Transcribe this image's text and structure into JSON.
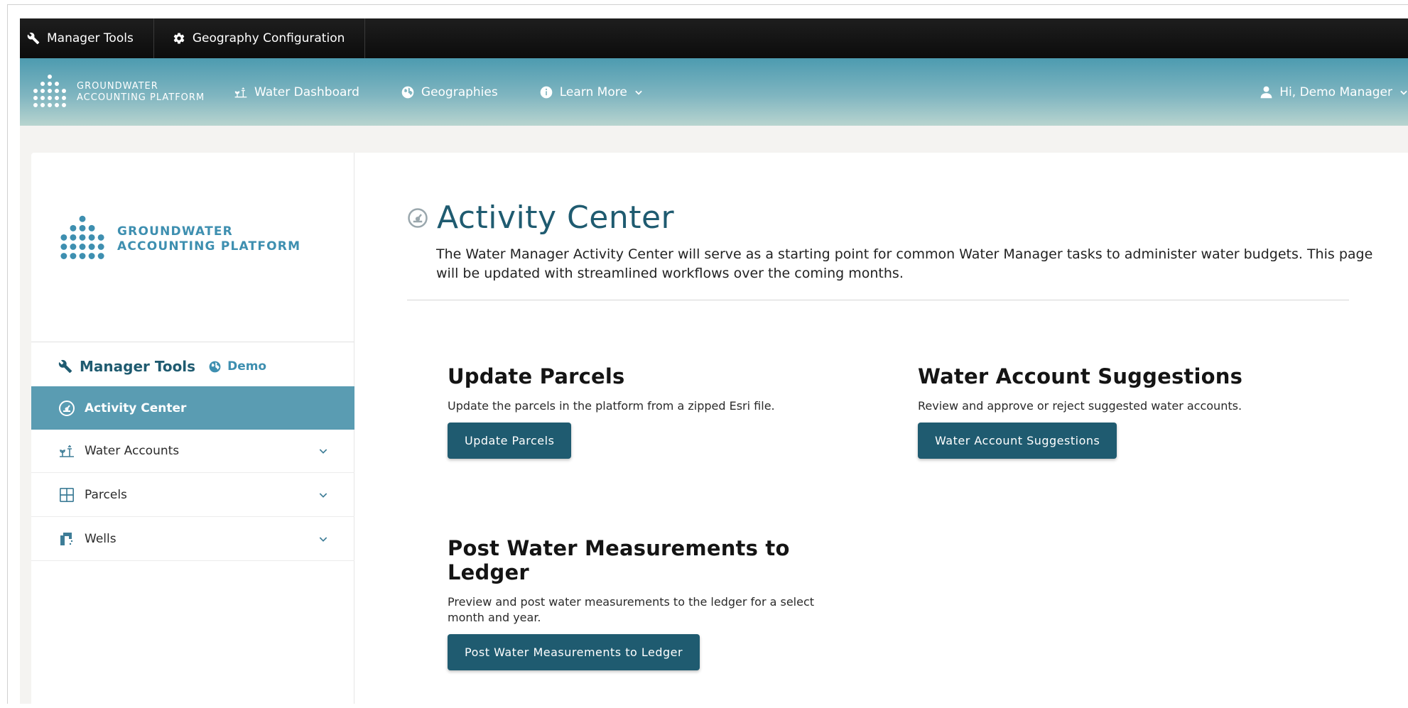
{
  "topbar": {
    "items": [
      {
        "label": "Manager Tools",
        "icon": "wrench-icon"
      },
      {
        "label": "Geography Configuration",
        "icon": "gear-icon"
      }
    ]
  },
  "navbar": {
    "brand_line1": "GROUNDWATER",
    "brand_line2": "ACCOUNTING PLATFORM",
    "links": [
      {
        "label": "Water Dashboard",
        "icon": "water-dashboard-icon"
      },
      {
        "label": "Geographies",
        "icon": "globe-icon"
      },
      {
        "label": "Learn More",
        "icon": "info-icon"
      }
    ],
    "user_label": "Hi, Demo Manager"
  },
  "sidebar": {
    "brand_line1": "GROUNDWATER",
    "brand_line2": "ACCOUNTING PLATFORM",
    "header_title": "Manager Tools",
    "header_sub": "Demo",
    "items": [
      {
        "label": "Activity Center",
        "icon": "dashboard-gauge-icon",
        "active": true
      },
      {
        "label": "Water Accounts",
        "icon": "water-account-icon"
      },
      {
        "label": "Parcels",
        "icon": "parcel-grid-icon"
      },
      {
        "label": "Wells",
        "icon": "well-icon"
      }
    ]
  },
  "main": {
    "title": "Activity Center",
    "description": "The Water Manager Activity Center will serve as a starting point for common Water Manager tasks to administer water budgets. This page will be updated with streamlined workflows over the coming months.",
    "tiles": [
      {
        "title": "Update Parcels",
        "text": "Update the parcels in the platform from a zipped Esri file.",
        "button": "Update Parcels"
      },
      {
        "title": "Water Account Suggestions",
        "text": "Review and approve or reject suggested water accounts.",
        "button": "Water Account Suggestions"
      },
      {
        "title": "Post Water Measurements to Ledger",
        "text": "Preview and post water measurements to the ledger for a select month and year.",
        "button": "Post Water Measurements to Ledger"
      }
    ]
  },
  "colors": {
    "accent_dark": "#1f5b70",
    "accent": "#3e8fb0",
    "sidebar_active": "#5a9cb2"
  }
}
